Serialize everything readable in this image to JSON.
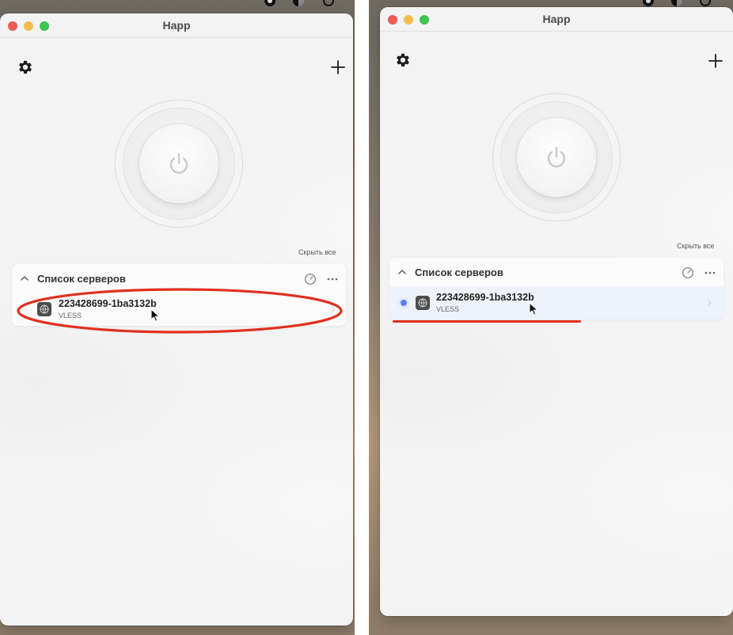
{
  "app": {
    "title": "Happ",
    "hide_all_label": "Скрыть все",
    "servers_section_title": "Список серверов"
  },
  "server": {
    "name": "223428699-1ba3132b",
    "protocol": "VLESS"
  },
  "icons": {
    "settings": "gear-icon",
    "add": "plus-icon",
    "power": "power-icon",
    "collapse": "chevron-up-icon",
    "speed_test": "speedometer-icon",
    "more": "ellipsis-icon",
    "server": "globe-icon",
    "open": "chevron-right-icon"
  },
  "colors": {
    "annotation": "#e0301e",
    "selection": "#5b7ff0",
    "close": "#ee5c55",
    "minimize": "#f5bd4f",
    "zoom": "#3fc34d"
  },
  "panels": [
    {
      "state": "hover",
      "annotation": "ellipse",
      "selected": false
    },
    {
      "state": "selected",
      "annotation": "underline",
      "selected": true
    }
  ]
}
